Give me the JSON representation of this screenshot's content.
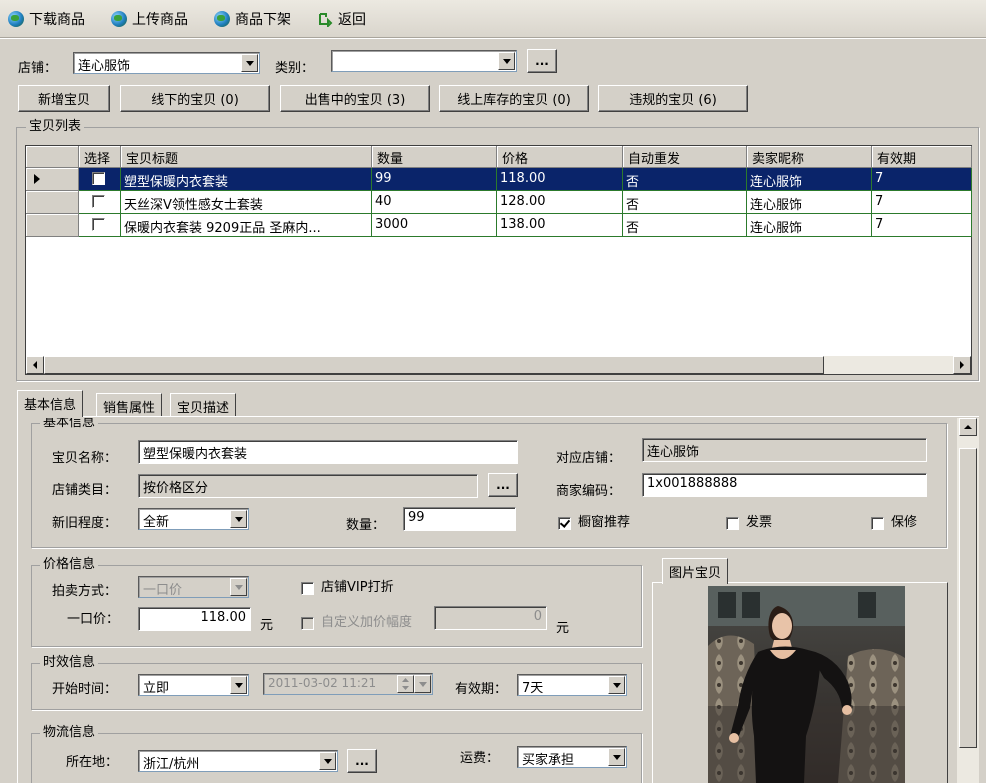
{
  "toolbar": {
    "items": [
      {
        "label": "下载商品",
        "icon": "globe-icon"
      },
      {
        "label": "上传商品",
        "icon": "globe-icon"
      },
      {
        "label": "商品下架",
        "icon": "globe-icon"
      },
      {
        "label": "返回",
        "icon": "back-arrow-icon"
      }
    ]
  },
  "filters": {
    "store_label": "店铺：",
    "store_value": "连心服饰",
    "category_label": "类别：",
    "category_value": "",
    "ellipsis": "..."
  },
  "actions": {
    "new_item": "新增宝贝",
    "offline": "线下的宝贝 (0)",
    "on_sale": "出售中的宝贝 (3)",
    "in_stock": "线上库存的宝贝 (0)",
    "violations": "违规的宝贝 (6)"
  },
  "item_list": {
    "title": "宝贝列表",
    "columns": [
      "选择",
      "宝贝标题",
      "数量",
      "价格",
      "自动重发",
      "卖家昵称",
      "有效期"
    ],
    "rows": [
      {
        "title": "塑型保暖内衣套装",
        "qty": "99",
        "price": "118.00",
        "auto_repost": "否",
        "seller": "连心服饰",
        "valid": "7",
        "selected": true
      },
      {
        "title": "天丝深V领性感女士套装",
        "qty": "40",
        "price": "128.00",
        "auto_repost": "否",
        "seller": "连心服饰",
        "valid": "7",
        "selected": false
      },
      {
        "title": "保暖内衣套装 9209正品 圣麻内...",
        "qty": "3000",
        "price": "138.00",
        "auto_repost": "否",
        "seller": "连心服饰",
        "valid": "7",
        "selected": false
      }
    ]
  },
  "tabs": [
    "基本信息",
    "销售属性",
    "宝贝描述"
  ],
  "basic": {
    "group_title": "基本信息",
    "name_label": "宝贝名称：",
    "name_value": "塑型保暖内衣套装",
    "store_cat_label": "店铺类目：",
    "store_cat_value": "按价格区分",
    "condition_label": "新旧程度：",
    "condition_value": "全新",
    "qty_label": "数量：",
    "qty_value": "99",
    "shop_label": "对应店铺：",
    "shop_value": "连心服饰",
    "code_label": "商家编码：",
    "code_value": "1x001888888",
    "window_label": "橱窗推荐",
    "window_checked": true,
    "invoice_label": "发票",
    "warranty_label": "保修"
  },
  "price": {
    "group_title": "价格信息",
    "auction_label": "拍卖方式：",
    "auction_value": "一口价",
    "vip_label": "店铺VIP打折",
    "fixed_label": "一口价：",
    "fixed_value": "118.00",
    "unit": "元",
    "custom_label": "自定义加价幅度",
    "custom_value": "0",
    "unit2": "元"
  },
  "timing": {
    "group_title": "时效信息",
    "start_label": "开始时间：",
    "start_value": "立即",
    "date_value": "2011-03-02 11:21",
    "valid_label": "有效期：",
    "valid_value": "7天"
  },
  "logistics": {
    "group_title": "物流信息",
    "location_label": "所在地：",
    "location_value": "浙江/杭州",
    "freight_label": "运费：",
    "freight_value": "买家承担"
  },
  "picture": {
    "tab_label": "图片宝贝"
  }
}
